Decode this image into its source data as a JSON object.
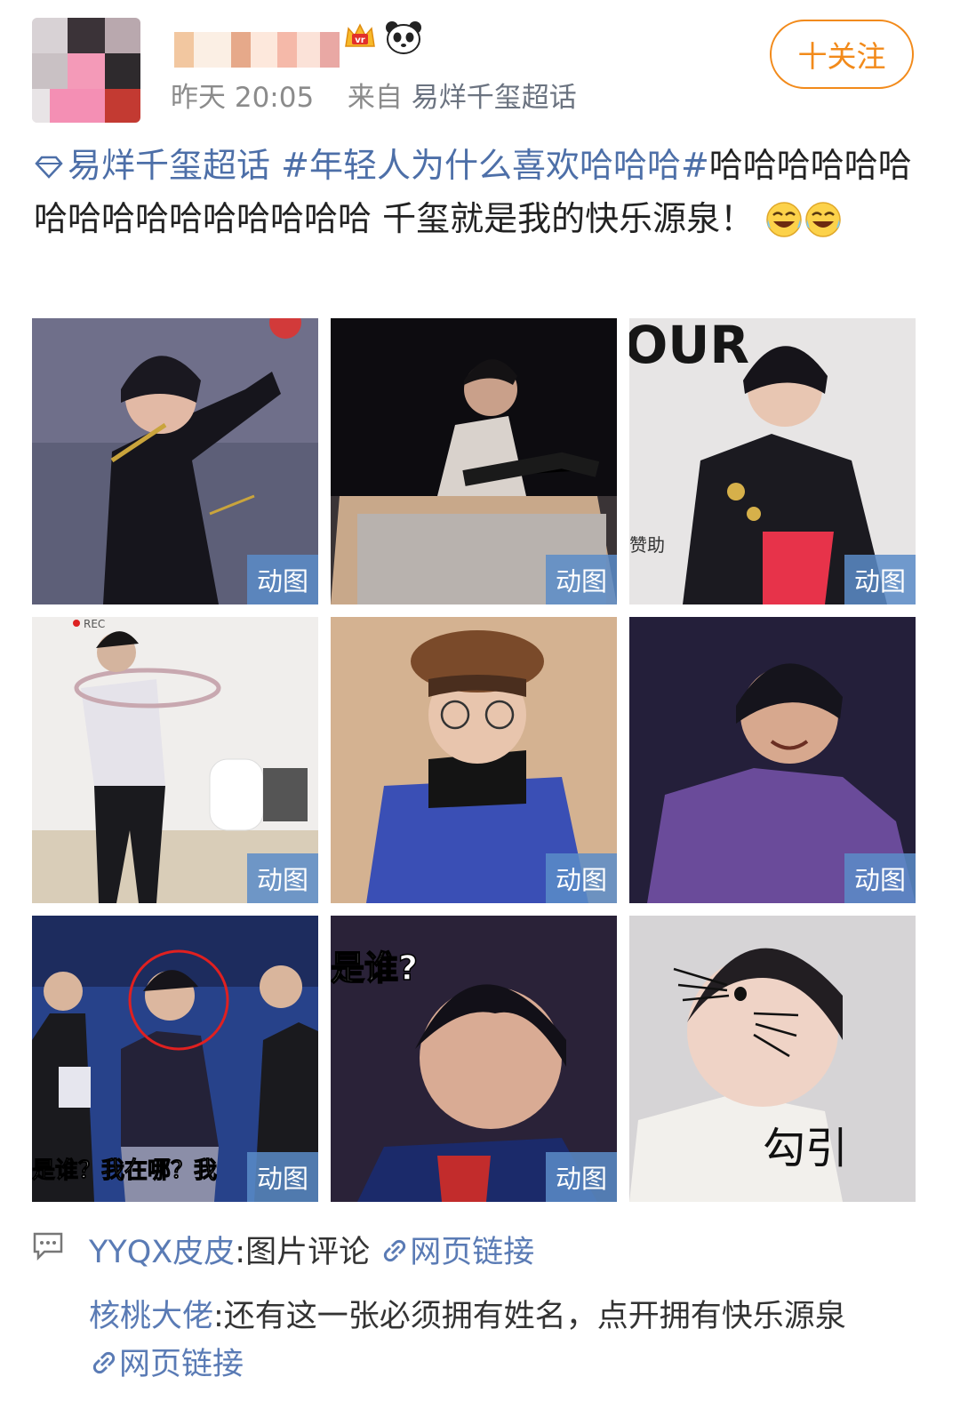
{
  "header": {
    "time": "昨天 20:05",
    "from_prefix": "来自",
    "source": "易烊千玺超话",
    "follow_label": "十关注"
  },
  "post": {
    "topic": "易烊千玺超话",
    "hashtag": "#年轻人为什么喜欢哈哈哈#",
    "body": "哈哈哈哈哈哈哈哈哈哈哈哈哈哈哈哈 千玺就是我的快乐源泉！"
  },
  "grid": {
    "gif_label": "动图",
    "captions": {
      "tile7": "是谁？我在哪？我",
      "tile8": "是谁?",
      "tile9": "勾引",
      "tile3": "OUR",
      "tile3_sponsor": "赞助",
      "tile4": "REC"
    }
  },
  "comments": [
    {
      "user": "YYQX皮皮",
      "text": ":图片评论",
      "link": "网页链接"
    },
    {
      "user": "核桃大佬",
      "text": ":还有这一张必须拥有姓名，点开拥有快乐源泉",
      "link": "网页链接"
    }
  ],
  "icons": [
    "diamond-icon",
    "crown-badge-icon",
    "panda-badge-icon",
    "laugh-cry-emoji-icon",
    "comment-icon",
    "link-icon"
  ],
  "colors": {
    "accent_orange": "#f28a1a",
    "link_blue": "#4d6fa8",
    "meta_gray": "#8b8b8b",
    "gif_badge": "#5a8cc8"
  }
}
